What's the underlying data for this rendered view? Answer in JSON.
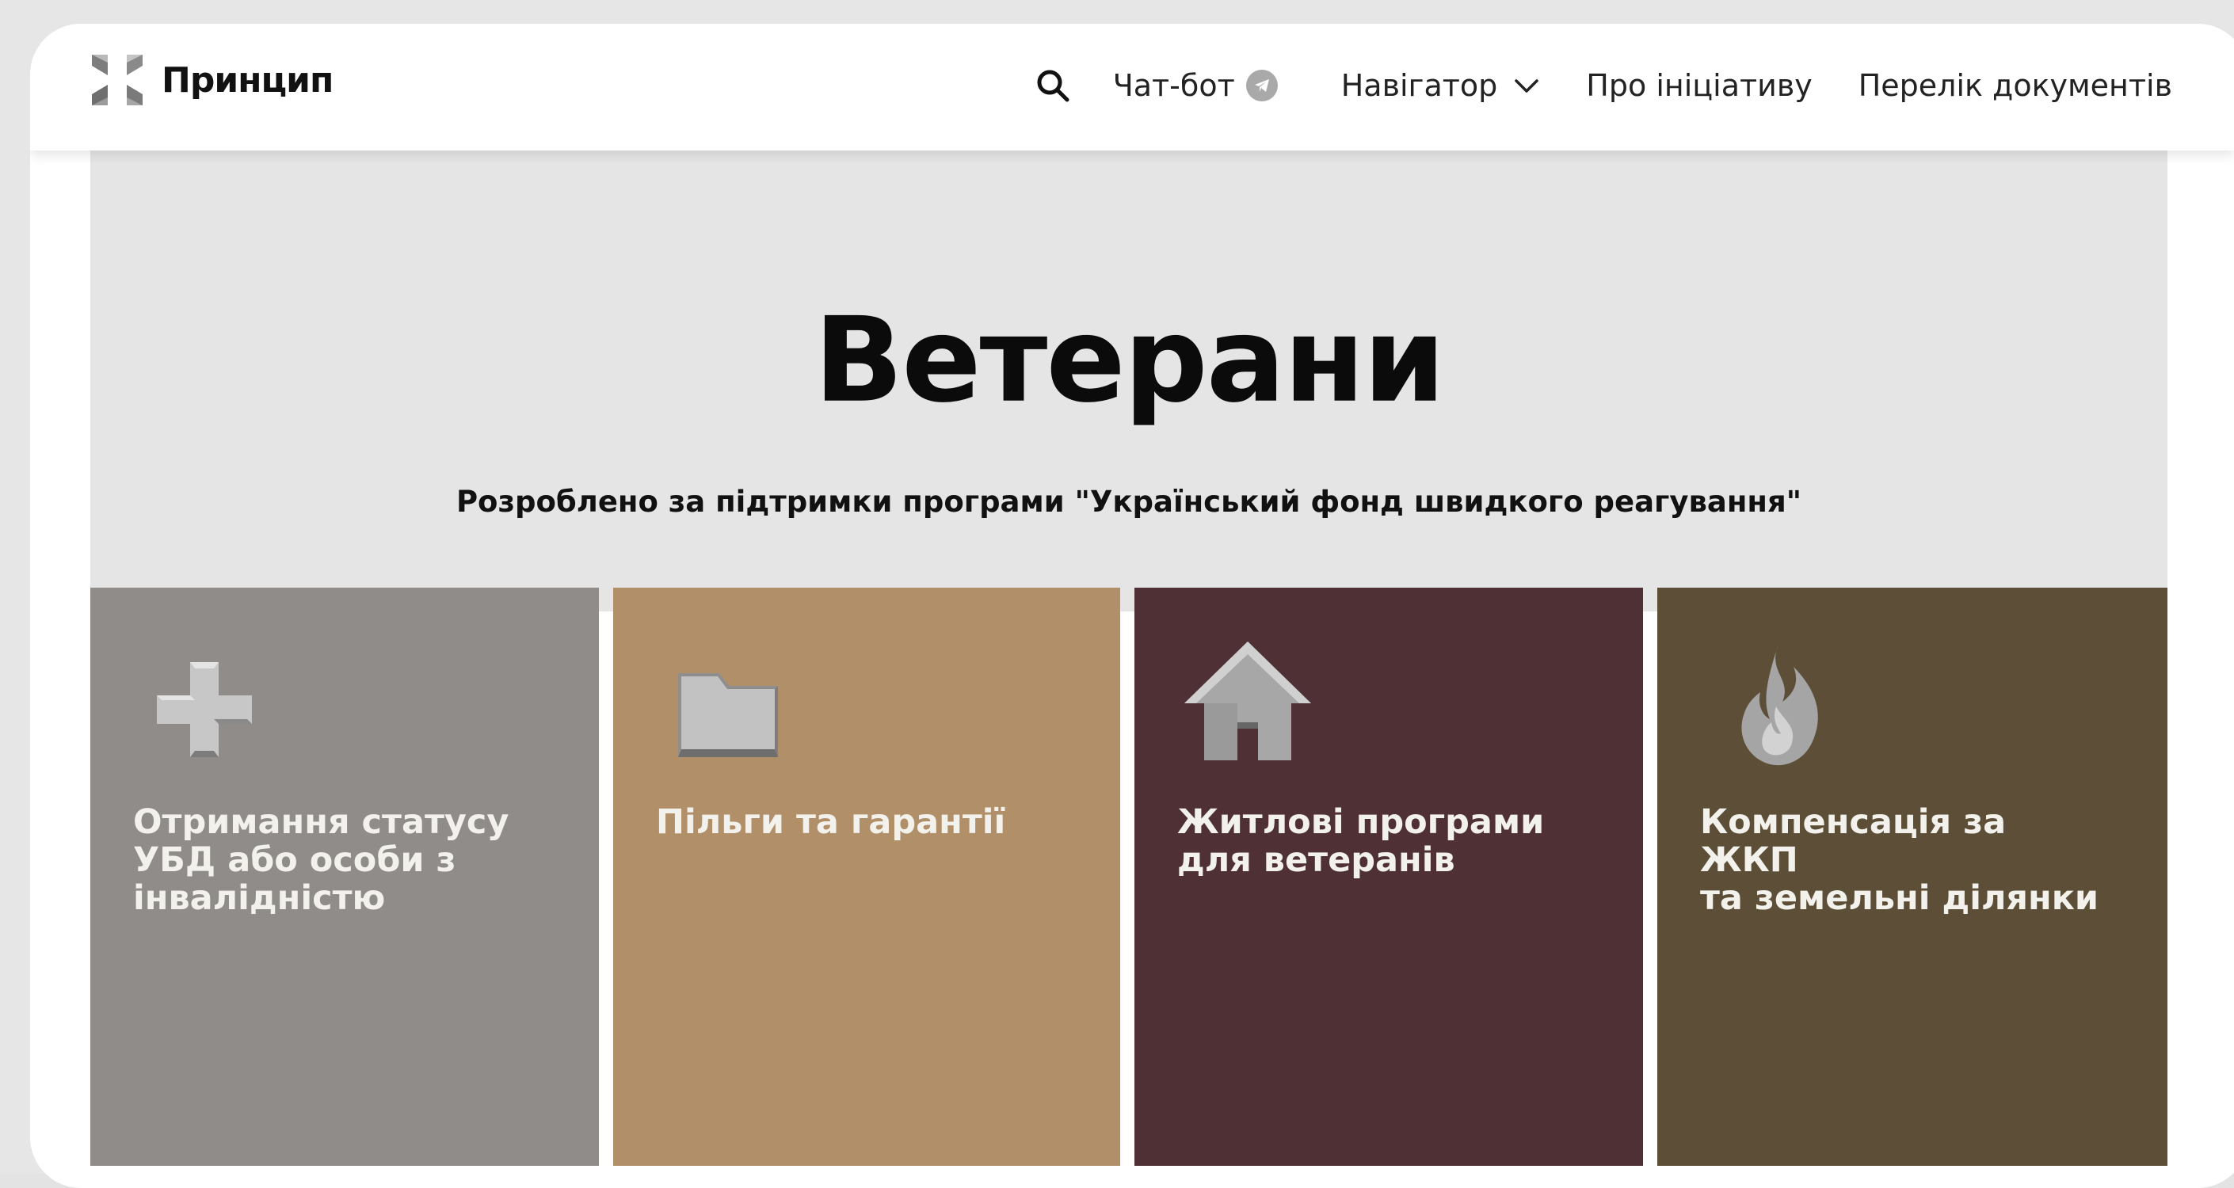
{
  "header": {
    "logo_text": "Принцип",
    "nav": {
      "chatbot_label": "Чат-бот",
      "navigator_label": "Навігатор",
      "about_label": "Про ініціативу",
      "documents_label": "Перелік документів"
    }
  },
  "hero": {
    "title": "Ветерани",
    "subtitle": "Розроблено за підтримки програми \"Український фонд швидкого реагування\""
  },
  "tiles": [
    {
      "label": "Отримання статусу\nУБД або особи з\nінвалідністю",
      "icon": "plus-icon",
      "color": "#8f8c8a"
    },
    {
      "label": "Пільги та гарантії",
      "icon": "folder-icon",
      "color": "#b08f69"
    },
    {
      "label": "Житлові програми\nдля ветеранів",
      "icon": "house-icon",
      "color": "#4f3135"
    },
    {
      "label": "Компенсація за ЖКП\nта земельні ділянки",
      "icon": "fire-icon",
      "color": "#5d4f37"
    }
  ],
  "colors": {
    "frame_bg": "#e6e6e6",
    "hero_bg": "#e5e5e5",
    "tile_text": "#f3f1ec"
  }
}
